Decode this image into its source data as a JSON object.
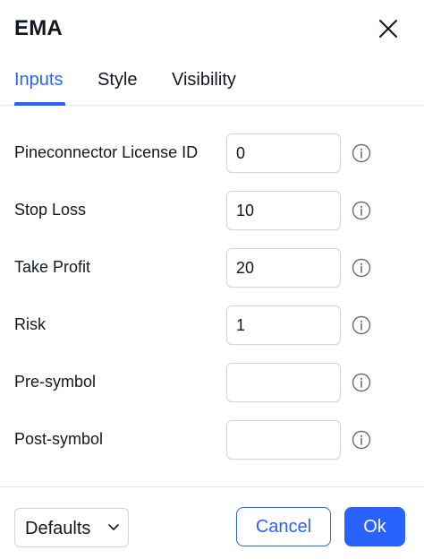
{
  "dialog": {
    "title": "EMA",
    "close_icon": "close-icon"
  },
  "tabs": [
    {
      "label": "Inputs",
      "active": true
    },
    {
      "label": "Style",
      "active": false
    },
    {
      "label": "Visibility",
      "active": false
    }
  ],
  "inputs": [
    {
      "label": "Pineconnector License ID",
      "value": "0"
    },
    {
      "label": "Stop Loss",
      "value": "10"
    },
    {
      "label": "Take Profit",
      "value": "20"
    },
    {
      "label": "Risk",
      "value": "1"
    },
    {
      "label": "Pre-symbol",
      "value": ""
    },
    {
      "label": "Post-symbol",
      "value": ""
    }
  ],
  "footer": {
    "defaults_label": "Defaults",
    "cancel_label": "Cancel",
    "ok_label": "Ok"
  },
  "colors": {
    "accent": "#2962ff",
    "text": "#131722",
    "border": "#d1d4dc",
    "info_icon": "#6a6d78"
  }
}
